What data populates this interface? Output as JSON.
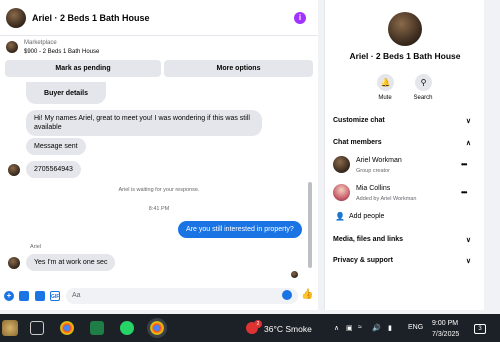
{
  "header": {
    "title": "Ariel · 2 Beds 1 Bath House",
    "info_icon": "i"
  },
  "marketplace": {
    "label": "Marketplace",
    "listing": "$900 - 2 Beds 1 Bath House",
    "mark_pending": "Mark as pending",
    "more_options": "More options"
  },
  "chat": {
    "buyer_details": "Buyer details",
    "msg1": "Hi! My names Ariel, great to meet you! I was wondering if this was still available",
    "msg2": "Message sent",
    "msg3": "2705564943",
    "waiting": "Ariel is waiting for your response.",
    "time": "8:41 PM",
    "mine": "Are you still interested in property?",
    "sender": "Ariel",
    "msg4": "Yes I'm at work one sec"
  },
  "composer": {
    "placeholder": "Aa"
  },
  "right": {
    "title": "Ariel · 2 Beds 1 Bath House",
    "mute": "Mute",
    "search": "Search",
    "customize": "Customize chat",
    "members": "Chat members",
    "member1_name": "Ariel Workman",
    "member1_sub": "Group creator",
    "member2_name": "Mia Collins",
    "member2_sub": "Added by Ariel Workman",
    "add_people": "Add people",
    "media": "Media, files and links",
    "privacy": "Privacy & support"
  },
  "taskbar": {
    "weather": "36°C  Smoke",
    "weather_badge": "2",
    "lang": "ENG",
    "time": "9:00 PM",
    "date": "7/3/2025",
    "notif": "3"
  },
  "colors": {
    "accent": "#1b74e4",
    "info": "#a033ff",
    "taskbar": "#1c2127"
  }
}
